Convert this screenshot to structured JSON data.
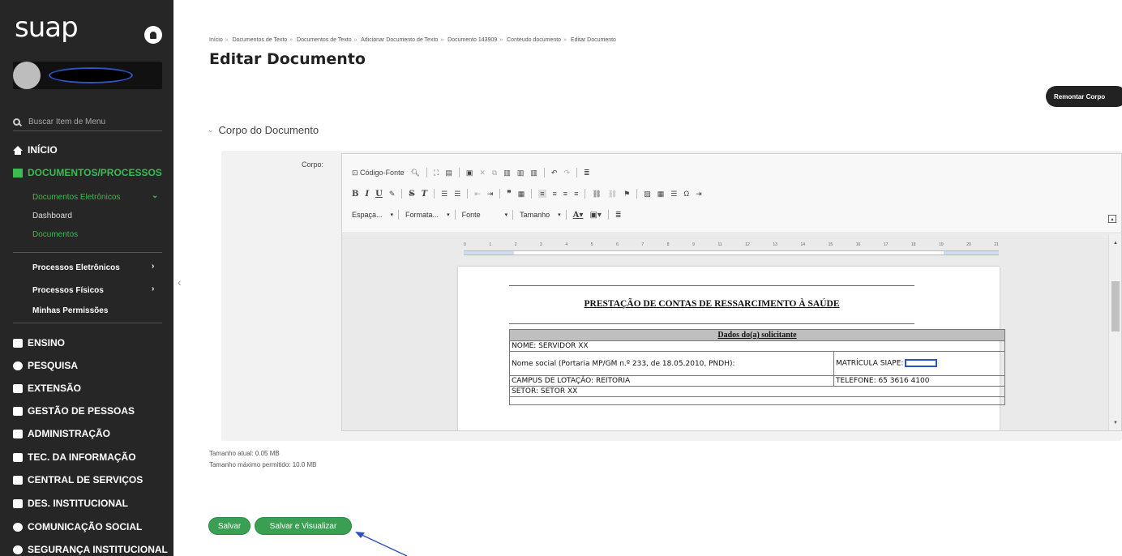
{
  "sidebar": {
    "logo": "suap",
    "search_placeholder": "Buscar Item de Menu",
    "menu": [
      {
        "label": "INÍCIO"
      },
      {
        "label": "DOCUMENTOS/PROCESSOS"
      },
      {
        "label": "ENSINO"
      },
      {
        "label": "PESQUISA"
      },
      {
        "label": "EXTENSÃO"
      },
      {
        "label": "GESTÃO DE PESSOAS"
      },
      {
        "label": "ADMINISTRAÇÃO"
      },
      {
        "label": "TEC. DA INFORMAÇÃO"
      },
      {
        "label": "CENTRAL DE SERVIÇOS"
      },
      {
        "label": "DES. INSTITUCIONAL"
      },
      {
        "label": "COMUNICAÇÃO SOCIAL"
      },
      {
        "label": "SEGURANÇA INSTITUCIONAL"
      }
    ],
    "submenu": {
      "docs_eletronicos": "Documentos Eletrônicos",
      "dashboard": "Dashboard",
      "documentos": "Documentos",
      "processos_eletronicos": "Processos Eletrônicos",
      "processos_fisicos": "Processos Físicos",
      "minhas_permissoes": "Minhas Permissões"
    }
  },
  "breadcrumb": [
    "Início",
    "Documentos de Texto",
    "Documentos de Texto",
    "Adicionar Documento de Texto",
    "Documento 143909",
    "Conteudo documento",
    "Editar Documento"
  ],
  "page_title": "Editar Documento",
  "remontar_button": "Remontar Corpo",
  "section_title": "Corpo do Documento",
  "field_label": "Corpo:",
  "toolbar": {
    "source": "Código-Fonte",
    "espaca": "Espaça...",
    "formata": "Formata...",
    "fonte": "Fonte",
    "tamanho": "Tamanho"
  },
  "ruler_numbers": [
    "0",
    "1",
    "2",
    "3",
    "4",
    "5",
    "6",
    "7",
    "8",
    "9",
    "11",
    "12",
    "13",
    "14",
    "15",
    "16",
    "17",
    "18",
    "19",
    "20",
    "21"
  ],
  "document": {
    "title": "PRESTAÇÃO DE CONTAS DE RESSARCIMENTO À SAÚDE",
    "table_header": "Dados do(a) solicitante",
    "nome": "NOME: SERVIDOR XX",
    "nome_social": "Nome social (Portaria MP/GM n.º 233, de 18.05.2010, PNDH):",
    "matricula": "MATRÍCULA SIAPE:",
    "campus": "CAMPUS DE LOTAÇÃO: REITORIA",
    "telefone": "TELEFONE: 65 3616 4100",
    "setor": "SETOR: SETOR XX"
  },
  "size_info": {
    "atual": "Tamanho atual: 0.05 MB",
    "maximo": "Tamanho máximo permitido: 10.0 MB"
  },
  "buttons": {
    "salvar": "Salvar",
    "salvar_visualizar": "Salvar e Visualizar"
  },
  "colors": {
    "sidebar_bg": "#262626",
    "accent_green": "#3cba54",
    "button_green": "#3a9f52",
    "annotation_blue": "#2d52c4"
  }
}
